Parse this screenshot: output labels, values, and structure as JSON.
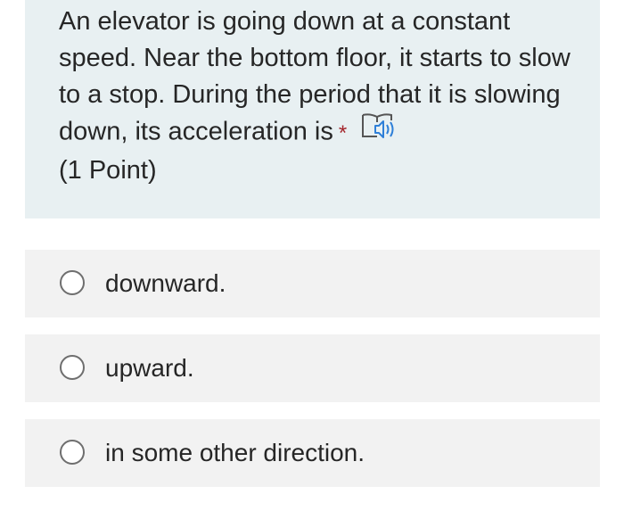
{
  "question": {
    "text": "An elevator is going down at a constant speed. Near the bottom floor, it starts to slow to a stop. During the period that it is slowing down, its acceleration is",
    "required_mark": "*",
    "points": "(1 Point)",
    "reader_icon": "immersive-reader-icon"
  },
  "options": [
    {
      "label": "downward."
    },
    {
      "label": "upward."
    },
    {
      "label": "in some other direction."
    }
  ],
  "colors": {
    "question_bg": "#e8f0f2",
    "option_bg": "#f2f2f2",
    "text": "#262626",
    "required": "#a4262c",
    "icon_blue": "#2e7fd8"
  }
}
